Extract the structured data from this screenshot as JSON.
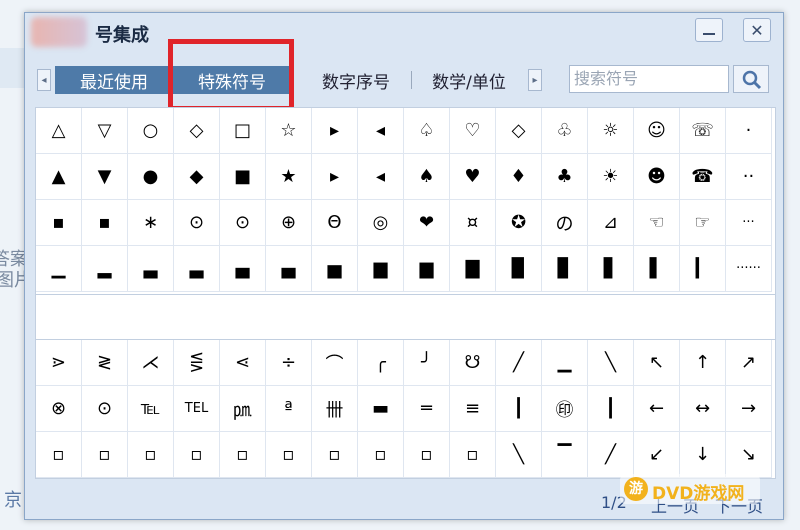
{
  "backdrop": {
    "text_a": "答案",
    "text_b": "图片",
    "text_c": "京"
  },
  "window": {
    "title": "号集成",
    "min_label": "",
    "close_label": "✕"
  },
  "tabs": {
    "left_arrow": "◂",
    "right_arrow": "▸",
    "items": [
      {
        "label": "最近使用"
      },
      {
        "label": "特殊符号"
      },
      {
        "label": "数字序号"
      },
      {
        "label": "数学/单位"
      }
    ]
  },
  "search": {
    "placeholder": "搜索符号"
  },
  "symbols_top": [
    "△",
    "▽",
    "○",
    "◇",
    "□",
    "☆",
    "▸",
    "◂",
    "♤",
    "♡",
    "◇",
    "♧",
    "☼",
    "☺",
    "☏",
    "·",
    "▲",
    "▼",
    "●",
    "◆",
    "■",
    "★",
    "▸",
    "◂",
    "♠",
    "♥",
    "♦",
    "♣",
    "☀",
    "☻",
    "☎",
    "··",
    "▪",
    "▪",
    "∗",
    "⊙",
    "⊙",
    "⊕",
    "Θ",
    "◎",
    "❤",
    "¤",
    "✪",
    "の",
    "⊿",
    "☜",
    "☞",
    "···",
    "▁",
    "▂",
    "▃",
    "▃",
    "▄",
    "▄",
    "▅",
    "▆",
    "▆",
    "▇",
    "▉",
    "▊",
    "▋",
    "▌",
    "▎",
    "······"
  ],
  "symbols_bottom": [
    "⋗",
    "≷",
    "⋌",
    "⋚",
    "⋖",
    "÷",
    "⌒",
    "╭",
    "╯",
    "☋",
    "╱",
    "▁",
    "╲",
    "↖",
    "↑",
    "↗",
    "⊗",
    "⊙",
    "℡",
    "TEL",
    "㏘",
    "ª",
    "卌",
    "▬",
    "═",
    "≡",
    "┃",
    "㊞",
    "┃",
    "←",
    "↔",
    "→",
    "▫",
    "▫",
    "▫",
    "▫",
    "▫",
    "▫",
    "▫",
    "▫",
    "▫",
    "▫",
    "╲",
    "▔",
    "╱",
    "↙",
    "↓",
    "↘"
  ],
  "footer": {
    "page": "1/2",
    "prev": "上一页",
    "next": "下一页"
  },
  "watermark": {
    "logo": "游",
    "text": "DVD游戏网"
  }
}
